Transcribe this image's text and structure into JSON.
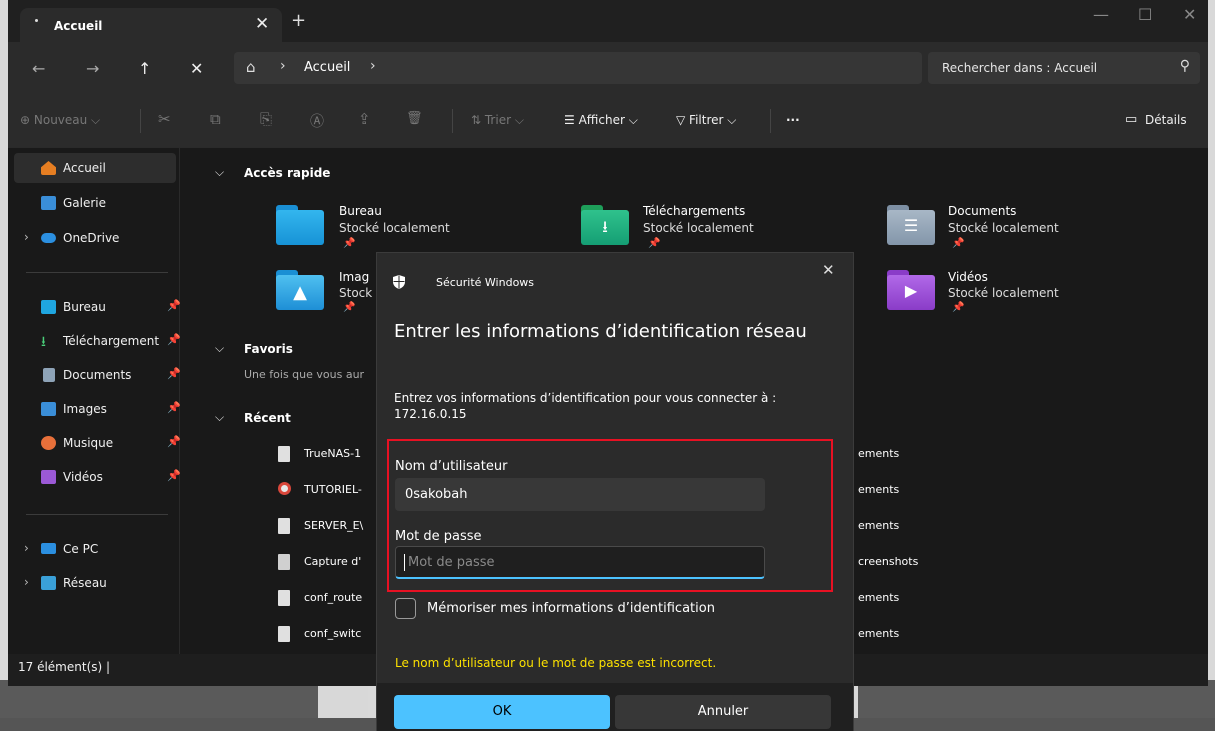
{
  "tab": {
    "title": "Accueil",
    "close": "✕",
    "new": "+"
  },
  "window": {
    "minimize": "—",
    "maximize": "☐",
    "close": "✕"
  },
  "nav": {
    "back": "←",
    "forward": "→",
    "up": "↑",
    "stop": "✕"
  },
  "address": {
    "home": "⌂",
    "sep": "›",
    "crumb": "Accueil"
  },
  "search": {
    "placeholder": "Rechercher dans : Accueil",
    "icon": "⚲"
  },
  "toolbar": {
    "new": "⊕ Nouveau ⌵",
    "cut": "✂",
    "copy": "⧉",
    "paste": "⎘",
    "rename": "Ⓐ",
    "share": "⇪",
    "delete": "🗑",
    "sort": "⇅ Trier ⌵",
    "view": "☰ Afficher ⌵",
    "filter": "▽ Filtrer ⌵",
    "more": "···",
    "details": "Détails"
  },
  "sidebar": {
    "items": [
      {
        "label": "Accueil"
      },
      {
        "label": "Galerie"
      },
      {
        "label": "OneDrive"
      },
      {
        "label": "Bureau"
      },
      {
        "label": "Téléchargement"
      },
      {
        "label": "Documents"
      },
      {
        "label": "Images"
      },
      {
        "label": "Musique"
      },
      {
        "label": "Vidéos"
      },
      {
        "label": "Ce PC"
      },
      {
        "label": "Réseau"
      }
    ],
    "chevron": "›",
    "pin": "📌"
  },
  "content": {
    "quick_access": "Accès rapide",
    "favorites": "Favoris",
    "favorites_text": "Une fois que vous aur",
    "recent": "Récent",
    "chevron": "⌵",
    "folders": [
      {
        "name": "Bureau",
        "sub": "Stocké localement"
      },
      {
        "name": "Téléchargements",
        "sub": "Stocké localement"
      },
      {
        "name": "Documents",
        "sub": "Stocké localement"
      },
      {
        "name": "Imag",
        "sub": "Stock"
      },
      {
        "name": "Vidéos",
        "sub": "Stocké localement"
      }
    ],
    "recent_items": [
      {
        "name": "TrueNAS-1",
        "location": "ements"
      },
      {
        "name": "TUTORIEL-",
        "location": "ements"
      },
      {
        "name": "SERVER_E\\",
        "location": "ements"
      },
      {
        "name": "Capture d'",
        "location": "creenshots"
      },
      {
        "name": "conf_route",
        "location": "ements"
      },
      {
        "name": "conf_switc",
        "location": "ements"
      }
    ],
    "pin": "📌"
  },
  "status": {
    "count": "17 élément(s)  |"
  },
  "dialog": {
    "app_name": "Sécurité Windows",
    "close": "✕",
    "title": "Entrer les informations d’identification réseau",
    "description": "Entrez vos informations d’identification pour vous connecter à :",
    "host": "172.16.0.15",
    "username_label": "Nom d’utilisateur",
    "username_value": "0sakobah",
    "password_label": "Mot de passe",
    "password_placeholder": "Mot de passe",
    "remember_label": "Mémoriser mes informations d’identification",
    "error": "Le nom d’utilisateur ou le mot de passe est incorrect.",
    "ok": "OK",
    "cancel": "Annuler"
  }
}
